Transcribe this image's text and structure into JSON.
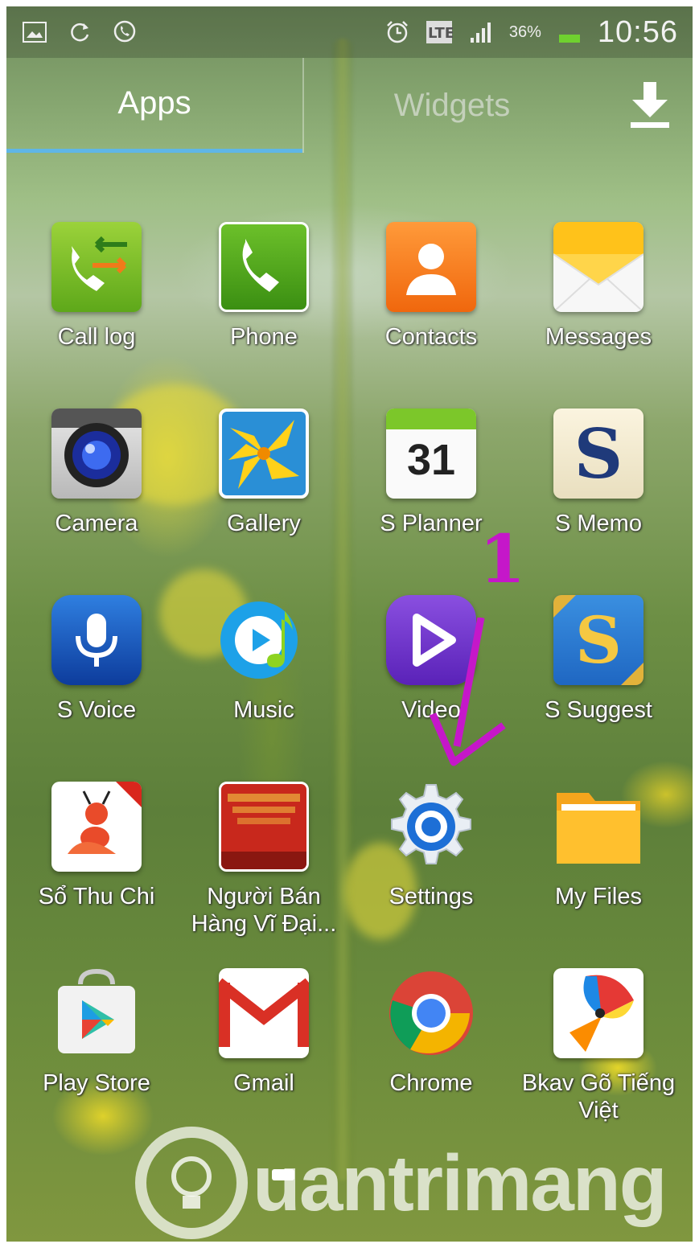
{
  "status_bar": {
    "battery_percent": "36%",
    "time": "10:56"
  },
  "tabs": {
    "apps": "Apps",
    "widgets": "Widgets"
  },
  "apps": [
    {
      "label": "Call log"
    },
    {
      "label": "Phone"
    },
    {
      "label": "Contacts"
    },
    {
      "label": "Messages"
    },
    {
      "label": "Camera"
    },
    {
      "label": "Gallery"
    },
    {
      "label": "S Planner",
      "icon_text": "31"
    },
    {
      "label": "S Memo",
      "icon_text": "S"
    },
    {
      "label": "S Voice"
    },
    {
      "label": "Music"
    },
    {
      "label": "Video"
    },
    {
      "label": "S Suggest",
      "icon_text": "S"
    },
    {
      "label": "Sổ Thu Chi"
    },
    {
      "label": "Người Bán Hàng Vĩ Đại..."
    },
    {
      "label": "Settings"
    },
    {
      "label": "My Files"
    },
    {
      "label": "Play Store"
    },
    {
      "label": "Gmail"
    },
    {
      "label": "Chrome"
    },
    {
      "label": "Bkav Gõ Tiếng Việt"
    }
  ],
  "annotation": {
    "step_number": "1",
    "color": "#c517c9"
  },
  "watermark": {
    "text": "uantrimang"
  },
  "colors": {
    "tab_indicator": "#5fb6e6"
  }
}
